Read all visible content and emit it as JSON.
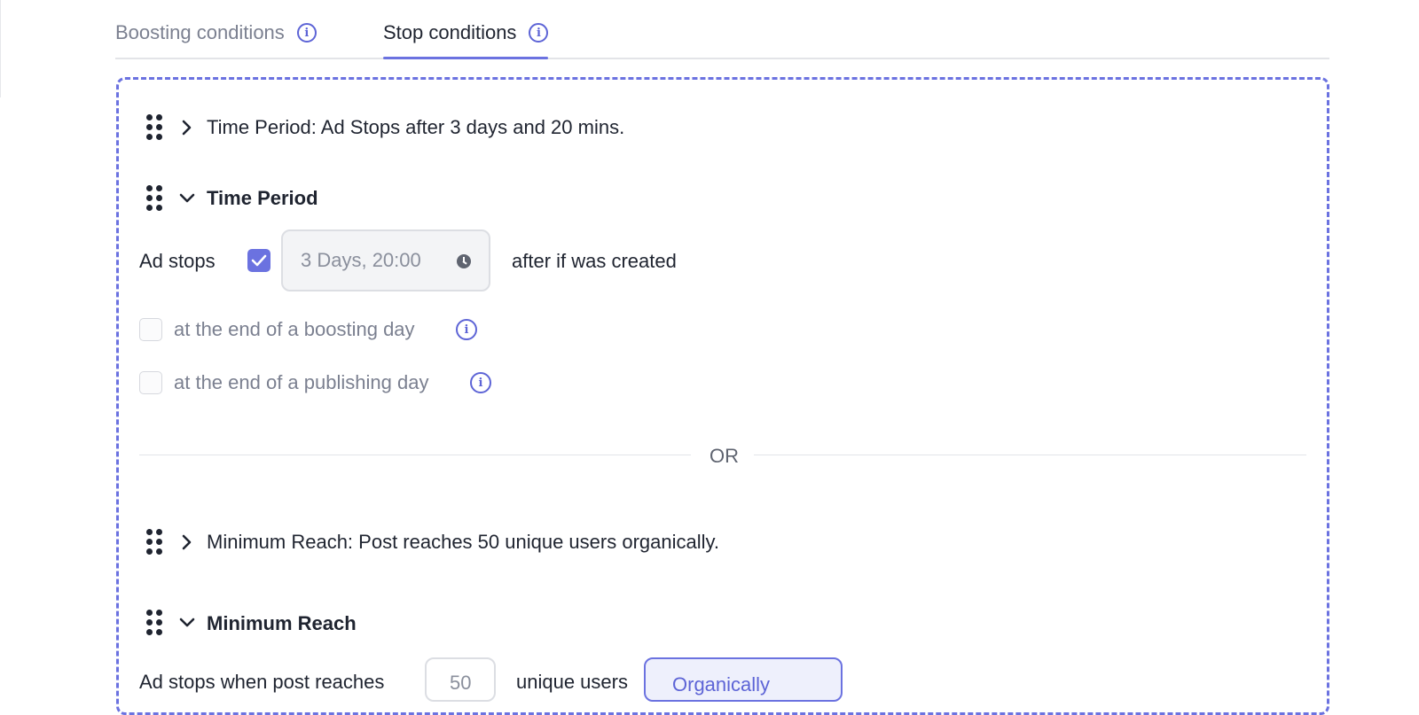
{
  "tabs": {
    "boosting": {
      "label": "Boosting conditions"
    },
    "stop": {
      "label": "Stop conditions"
    }
  },
  "conditions": {
    "time_period_summary": "Time Period: Ad Stops after 3 days and 20 mins.",
    "time_period_title": "Time Period",
    "ad_stops_label": "Ad stops",
    "ad_stops_checked": true,
    "time_value": "3 Days, 20:00",
    "after_created_text": "after if was created",
    "boosting_day_label": "at the end of a boosting day",
    "boosting_day_checked": false,
    "publishing_day_label": "at the end of a publishing day",
    "publishing_day_checked": false,
    "or_separator": "OR",
    "min_reach_summary": "Minimum Reach: Post reaches 50 unique users organically.",
    "min_reach_title": "Minimum Reach",
    "min_reach_text_partial": "Ad stops when post reaches",
    "min_reach_value": "50",
    "min_reach_unit_partial": "unique users",
    "organically_button": "Organically"
  },
  "colors": {
    "accent": "#6b72e0",
    "text": "#1f2430",
    "muted": "#7b8090",
    "border": "#dcdee3"
  }
}
